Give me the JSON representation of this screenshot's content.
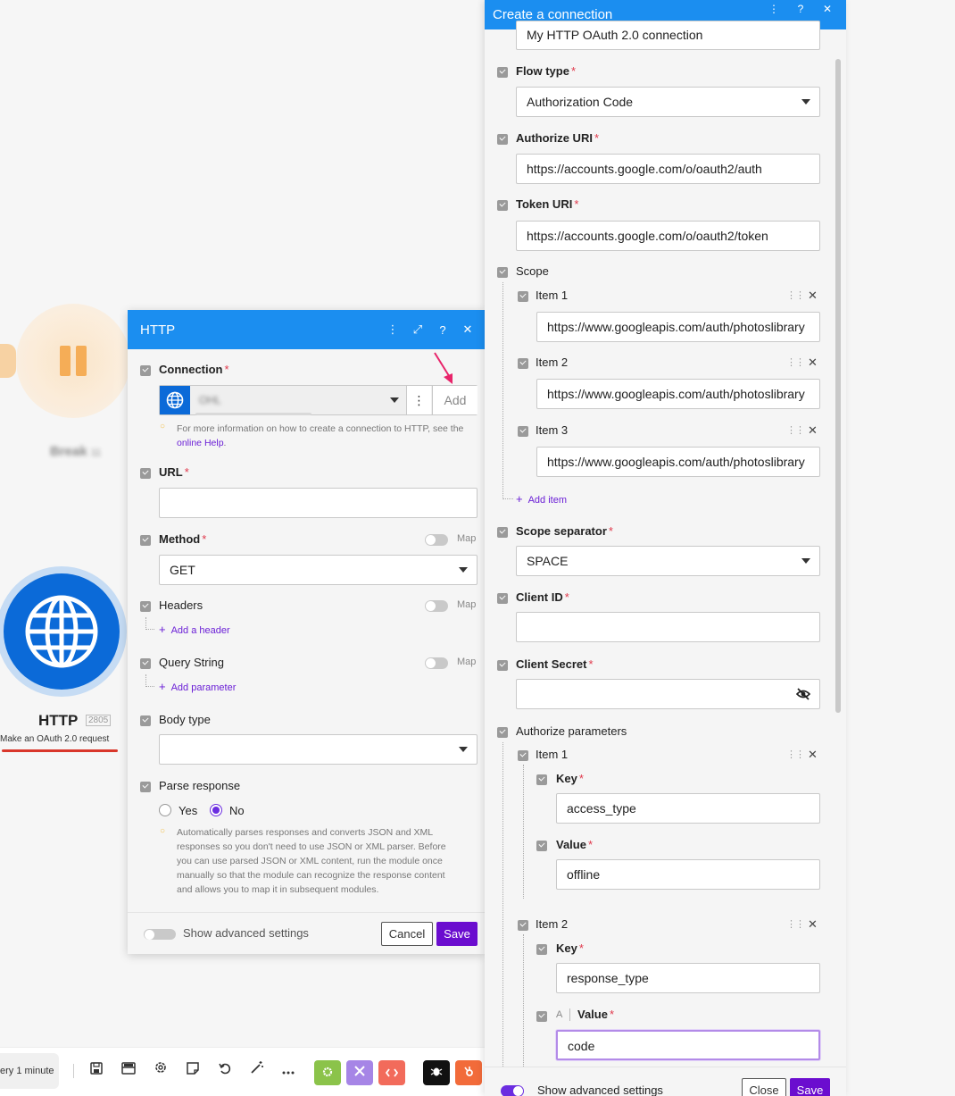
{
  "scenario": {
    "sleep_module_label": "Break",
    "sleep_module_id": "11",
    "http_module_title": "HTTP",
    "http_module_id": "2805",
    "http_module_subtitle": "Make an OAuth 2.0 request"
  },
  "toolbar": {
    "schedule_text": "ery 1 minute"
  },
  "http_panel": {
    "title": "HTTP",
    "connection": {
      "label": "Connection",
      "value": "OHL",
      "add_label": "Add",
      "help_text": "For more information on how to create a connection to HTTP, see the ",
      "help_link": "online Help",
      "help_end": "."
    },
    "url": {
      "label": "URL",
      "value": ""
    },
    "method": {
      "label": "Method",
      "value": "GET",
      "map_label": "Map"
    },
    "headers": {
      "label": "Headers",
      "map_label": "Map",
      "add_label": "Add a header"
    },
    "query_string": {
      "label": "Query String",
      "map_label": "Map",
      "add_label": "Add parameter"
    },
    "body_type": {
      "label": "Body type",
      "value": ""
    },
    "parse_response": {
      "label": "Parse response",
      "options": [
        "Yes",
        "No"
      ],
      "selected": "No",
      "help_lines": [
        "Automatically parses responses and converts JSON and XML",
        "responses so you don't need to use JSON or XML parser. Before",
        "you can use parsed JSON or XML content, run the module once",
        "manually so that the module can recognize the response content",
        "and allows you to map it in subsequent modules."
      ]
    },
    "footer": {
      "advanced_label": "Show advanced settings",
      "cancel_label": "Cancel",
      "save_label": "Save"
    }
  },
  "connection_panel": {
    "title": "Create a connection",
    "connection_name_value": "My HTTP OAuth 2.0 connection",
    "flow_type": {
      "label": "Flow type",
      "value": "Authorization Code"
    },
    "authorize_uri": {
      "label": "Authorize URI",
      "value": "https://accounts.google.com/o/oauth2/auth"
    },
    "token_uri": {
      "label": "Token URI",
      "value": "https://accounts.google.com/o/oauth2/token"
    },
    "scope": {
      "label": "Scope",
      "items": [
        {
          "label": "Item 1",
          "value": "https://www.googleapis.com/auth/photoslibrary"
        },
        {
          "label": "Item 2",
          "value": "https://www.googleapis.com/auth/photoslibrary"
        },
        {
          "label": "Item 3",
          "value": "https://www.googleapis.com/auth/photoslibrary"
        }
      ],
      "add_label": "Add item"
    },
    "scope_separator": {
      "label": "Scope separator",
      "value": "SPACE"
    },
    "client_id": {
      "label": "Client ID",
      "value": ""
    },
    "client_secret": {
      "label": "Client Secret",
      "value": ""
    },
    "authorize_parameters": {
      "label": "Authorize parameters",
      "key_label": "Key",
      "value_label": "Value",
      "mini_a": "A",
      "items": [
        {
          "label": "Item 1",
          "key": "access_type",
          "value": "offline"
        },
        {
          "label": "Item 2",
          "key": "response_type",
          "value": "code"
        }
      ]
    },
    "footer": {
      "advanced_label": "Show advanced settings",
      "close_label": "Close",
      "save_label": "Save"
    }
  },
  "colors": {
    "header_blue": "#1b8ef0",
    "http_blue": "#0b6ad8",
    "purple": "#6b0dcf",
    "required_red": "#e0384b",
    "annotation_pink": "#e8246a"
  }
}
